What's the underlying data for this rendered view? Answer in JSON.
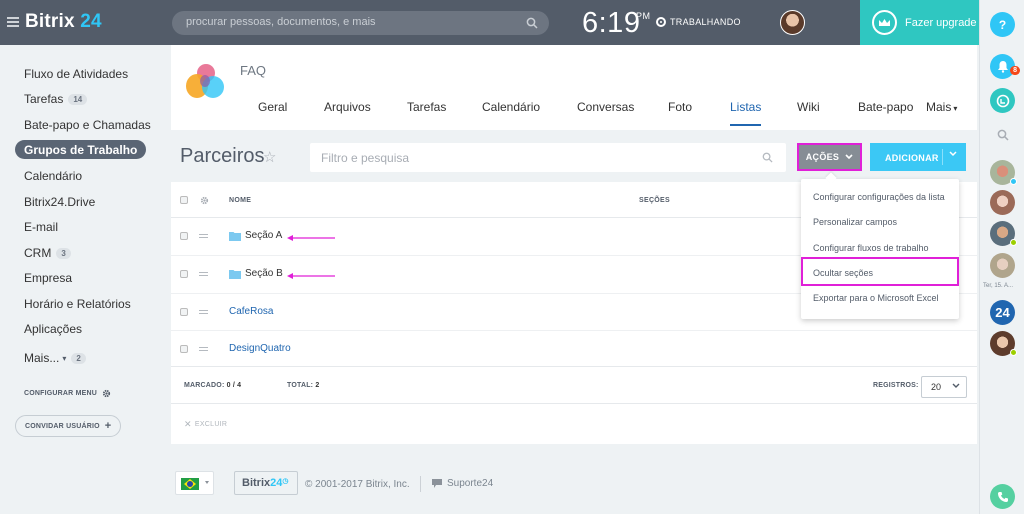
{
  "topbar": {
    "logo_word": "Bitrix",
    "logo_num": "24",
    "search_placeholder": "procurar pessoas, documentos, e mais",
    "time": "6:19",
    "ampm": "PM",
    "work_status": "TRABALHANDO",
    "upgrade_label": "Fazer upgrade"
  },
  "rightbar": {
    "help": "?",
    "notifications_count": "8",
    "date_label": "Ter, 15. A...",
    "b24": "24"
  },
  "sidebar": {
    "items": [
      {
        "label": "Fluxo de Atividades"
      },
      {
        "label": "Tarefas",
        "count": "14"
      },
      {
        "label": "Bate-papo e Chamadas"
      },
      {
        "label": "Grupos de Trabalho"
      },
      {
        "label": "Calendário"
      },
      {
        "label": "Bitrix24.Drive"
      },
      {
        "label": "E-mail"
      },
      {
        "label": "CRM",
        "count": "3"
      },
      {
        "label": "Empresa"
      },
      {
        "label": "Horário e Relatórios"
      },
      {
        "label": "Aplicações"
      },
      {
        "label": "Mais...",
        "count": "2"
      }
    ],
    "configure_menu": "CONFIGURAR MENU",
    "invite_user": "CONVIDAR USUÁRIO"
  },
  "group": {
    "name": "FAQ",
    "tabs": [
      "Geral",
      "Arquivos",
      "Tarefas",
      "Calendário",
      "Conversas",
      "Foto",
      "Listas",
      "Wiki",
      "Bate-papo",
      "Mais"
    ],
    "active_tab": "Listas"
  },
  "list": {
    "title": "Parceiros",
    "filter_placeholder": "Filtro e pesquisa",
    "actions_label": "AÇÕES",
    "add_label": "ADICIONAR",
    "columns": {
      "name": "NOME",
      "sections": "SEÇÕES"
    },
    "rows": [
      {
        "name": "Seção A",
        "type": "folder"
      },
      {
        "name": "Seção B",
        "type": "folder"
      },
      {
        "name": "CafeRosa",
        "type": "link"
      },
      {
        "name": "DesignQuatro",
        "type": "link"
      }
    ],
    "marked_label": "MARCADO:",
    "marked_value": "0 / 4",
    "total_label": "TOTAL:",
    "total_value": "2",
    "records_label": "REGISTROS:",
    "records_value": "20",
    "delete_label": "EXCLUIR"
  },
  "actions_menu": {
    "items": [
      "Configurar configurações da lista",
      "Personalizar campos",
      "Configurar fluxos de trabalho",
      "Ocultar seções",
      "Exportar para o Microsoft Excel"
    ],
    "highlighted": "Ocultar seções"
  },
  "footer": {
    "badge_word": "Bitrix",
    "badge_num": "24",
    "copyright": "© 2001-2017 Bitrix, Inc.",
    "support": "Suporte24"
  },
  "colors": {
    "topbar": "#535c69",
    "accent": "#2fc6f6",
    "upgrade": "#2fc7c1",
    "highlight": "#e020d8",
    "link": "#2066b0"
  }
}
